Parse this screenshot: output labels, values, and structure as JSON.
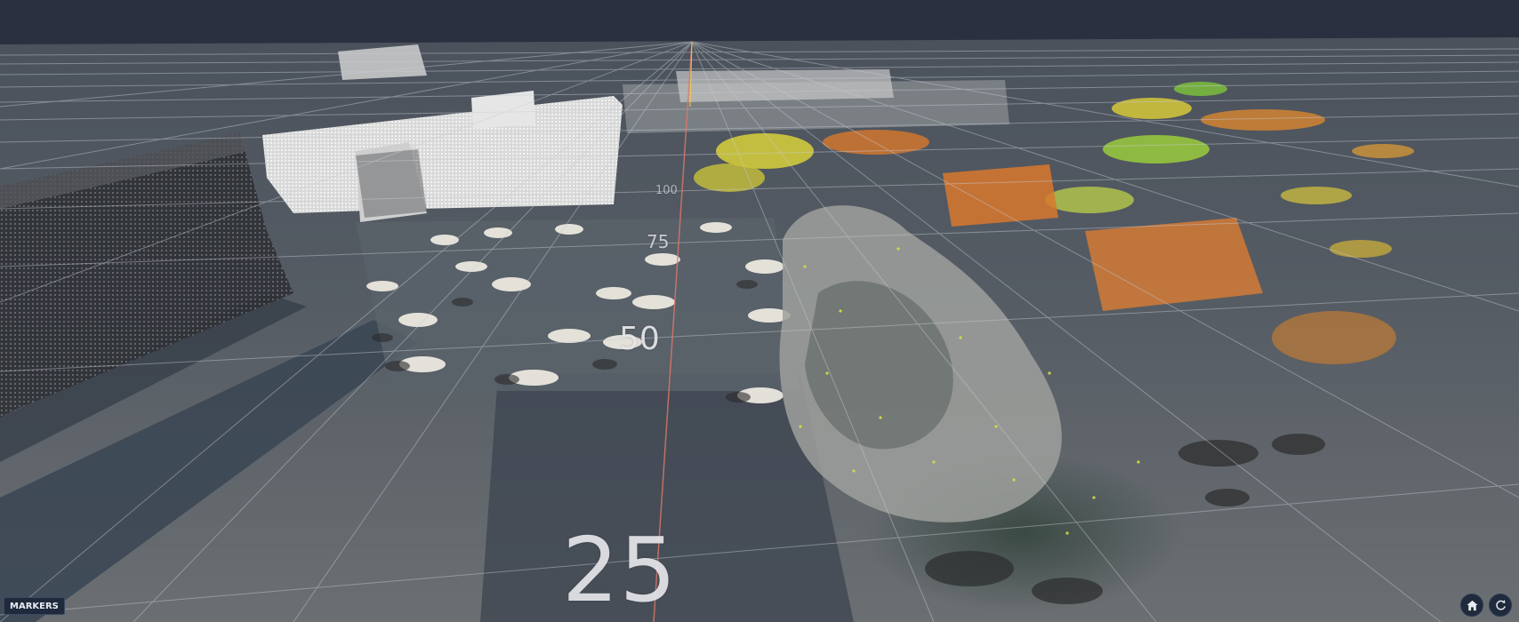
{
  "viewer": {
    "background_sky": "#2b3040",
    "axis_color": "#e0786a",
    "grid_color": "#c8ccd4",
    "distance_labels": {
      "near": "25",
      "mid": "50",
      "far": "75",
      "farthest": "100"
    }
  },
  "controls": {
    "markers_label": "MARKERS",
    "home_icon": "home-icon",
    "reset_icon": "reset-view-icon"
  },
  "palette": {
    "ground_dark": "#3d4550",
    "ground_light": "#6a7076",
    "building_white": "#e6e6e6",
    "vegetation_yellow": "#d9d23a",
    "vegetation_orange": "#d9782e",
    "vegetation_green": "#86c23a",
    "tree_gray": "#a9aca6"
  }
}
